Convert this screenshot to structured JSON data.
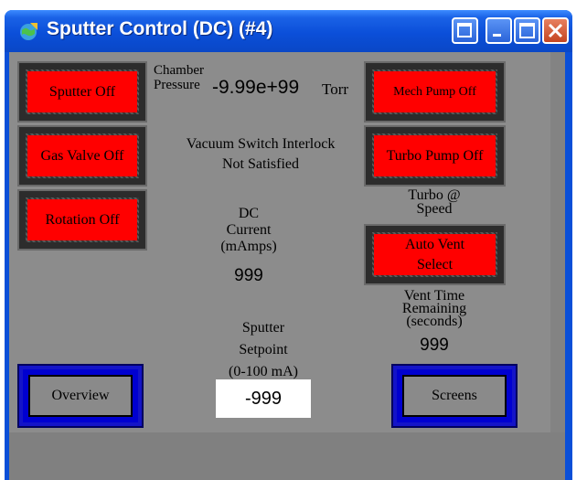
{
  "window": {
    "title": "Sputter Control (DC) (#4)",
    "colors": {
      "titlebar": "#0a4fd8",
      "panel": "#8c8c8c",
      "button_red": "#ff0000",
      "button_blue": "#0000d0"
    }
  },
  "buttons": {
    "sputter": "Sputter Off",
    "gas_valve": "Gas Valve Off",
    "rotation": "Rotation Off",
    "mech_pump": "Mech Pump Off",
    "turbo_pump": "Turbo Pump Off",
    "auto_vent_line1": "Auto Vent",
    "auto_vent_line2": "Select",
    "overview": "Overview",
    "screens": "Screens"
  },
  "chamber": {
    "label_line1": "Chamber",
    "label_line2": "Pressure",
    "value": "-9.99e+99",
    "unit": "Torr"
  },
  "interlock": {
    "line1": "Vacuum Switch Interlock",
    "line2": "Not Satisfied"
  },
  "current": {
    "line1": "DC",
    "line2": "Current",
    "line3": "(mAmps)",
    "value": "999"
  },
  "turbo_speed": {
    "line1": "Turbo @",
    "line2": "Speed"
  },
  "vent_time": {
    "line1": "Vent Time",
    "line2": "Remaining",
    "line3": "(seconds)",
    "value": "999"
  },
  "setpoint": {
    "line1": "Sputter",
    "line2": "Setpoint",
    "line3": "(0-100 mA)",
    "value": "-999"
  }
}
